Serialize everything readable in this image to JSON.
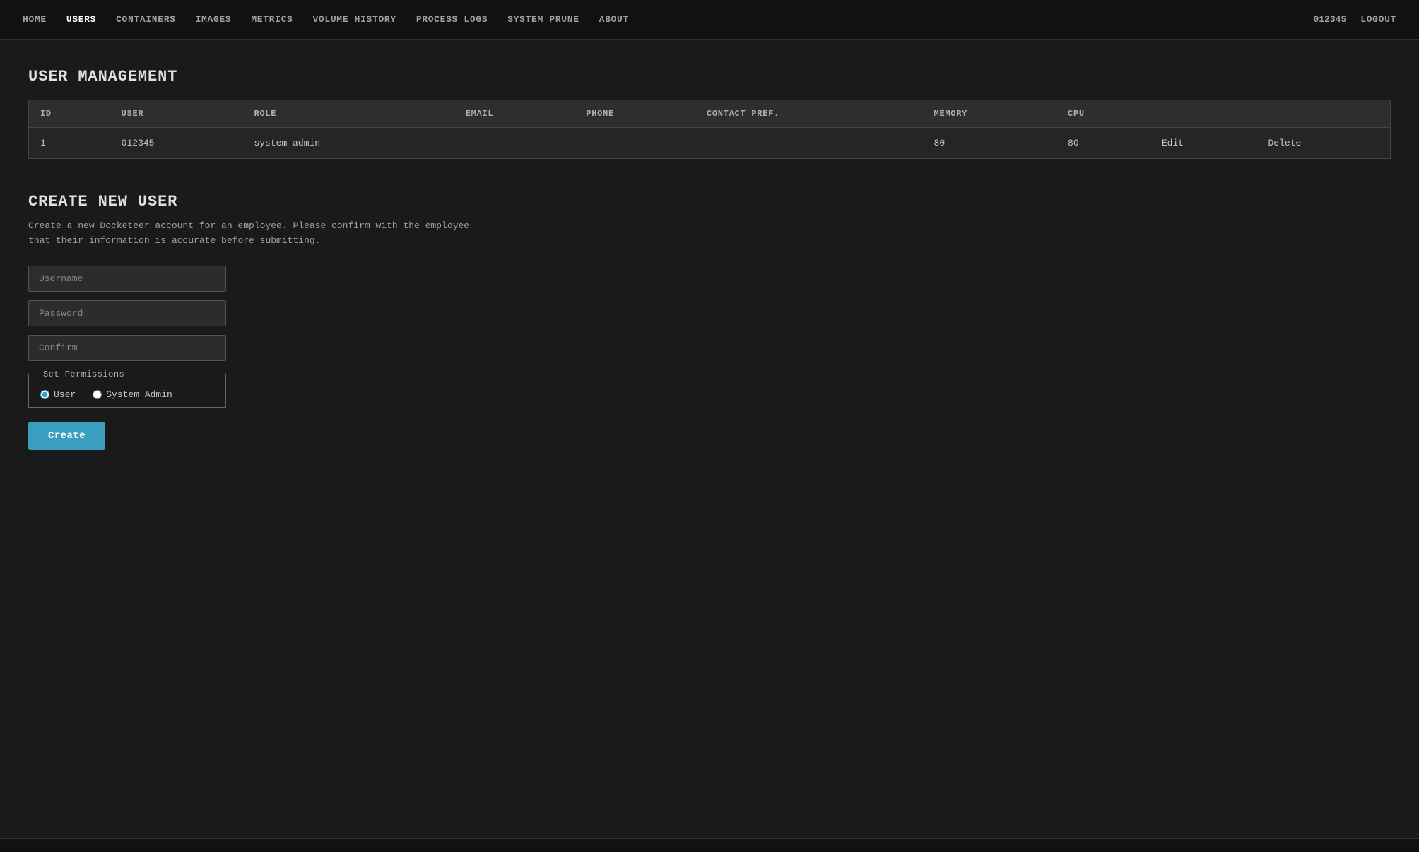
{
  "nav": {
    "links": [
      {
        "id": "home",
        "label": "HOME",
        "active": false
      },
      {
        "id": "users",
        "label": "USERS",
        "active": true
      },
      {
        "id": "containers",
        "label": "CONTAINERS",
        "active": false
      },
      {
        "id": "images",
        "label": "IMAGES",
        "active": false
      },
      {
        "id": "metrics",
        "label": "METRICS",
        "active": false
      },
      {
        "id": "volume_history",
        "label": "VOLUME HISTORY",
        "active": false
      },
      {
        "id": "process_logs",
        "label": "PROCESS LOGS",
        "active": false
      },
      {
        "id": "system_prune",
        "label": "SYSTEM PRUNE",
        "active": false
      },
      {
        "id": "about",
        "label": "ABOUT",
        "active": false
      }
    ],
    "username": "012345",
    "logout_label": "LOGOUT"
  },
  "user_management": {
    "title": "USER MANAGEMENT",
    "table": {
      "columns": [
        "ID",
        "USER",
        "ROLE",
        "EMAIL",
        "PHONE",
        "CONTACT PREF.",
        "MEMORY",
        "CPU"
      ],
      "rows": [
        {
          "id": "1",
          "user": "012345",
          "role": "system admin",
          "email": "",
          "phone": "",
          "contact_pref": "",
          "memory": "80",
          "cpu": "80",
          "edit_label": "Edit",
          "delete_label": "Delete"
        }
      ]
    }
  },
  "create_user": {
    "title": "CREATE NEW USER",
    "description": "Create a new Docketeer account for an employee. Please confirm with the employee that their information is accurate before submitting.",
    "username_placeholder": "Username",
    "password_placeholder": "Password",
    "confirm_placeholder": "Confirm",
    "permissions_legend": "Set Permissions",
    "radio_user_label": "User",
    "radio_admin_label": "System Admin",
    "create_button_label": "Create"
  }
}
